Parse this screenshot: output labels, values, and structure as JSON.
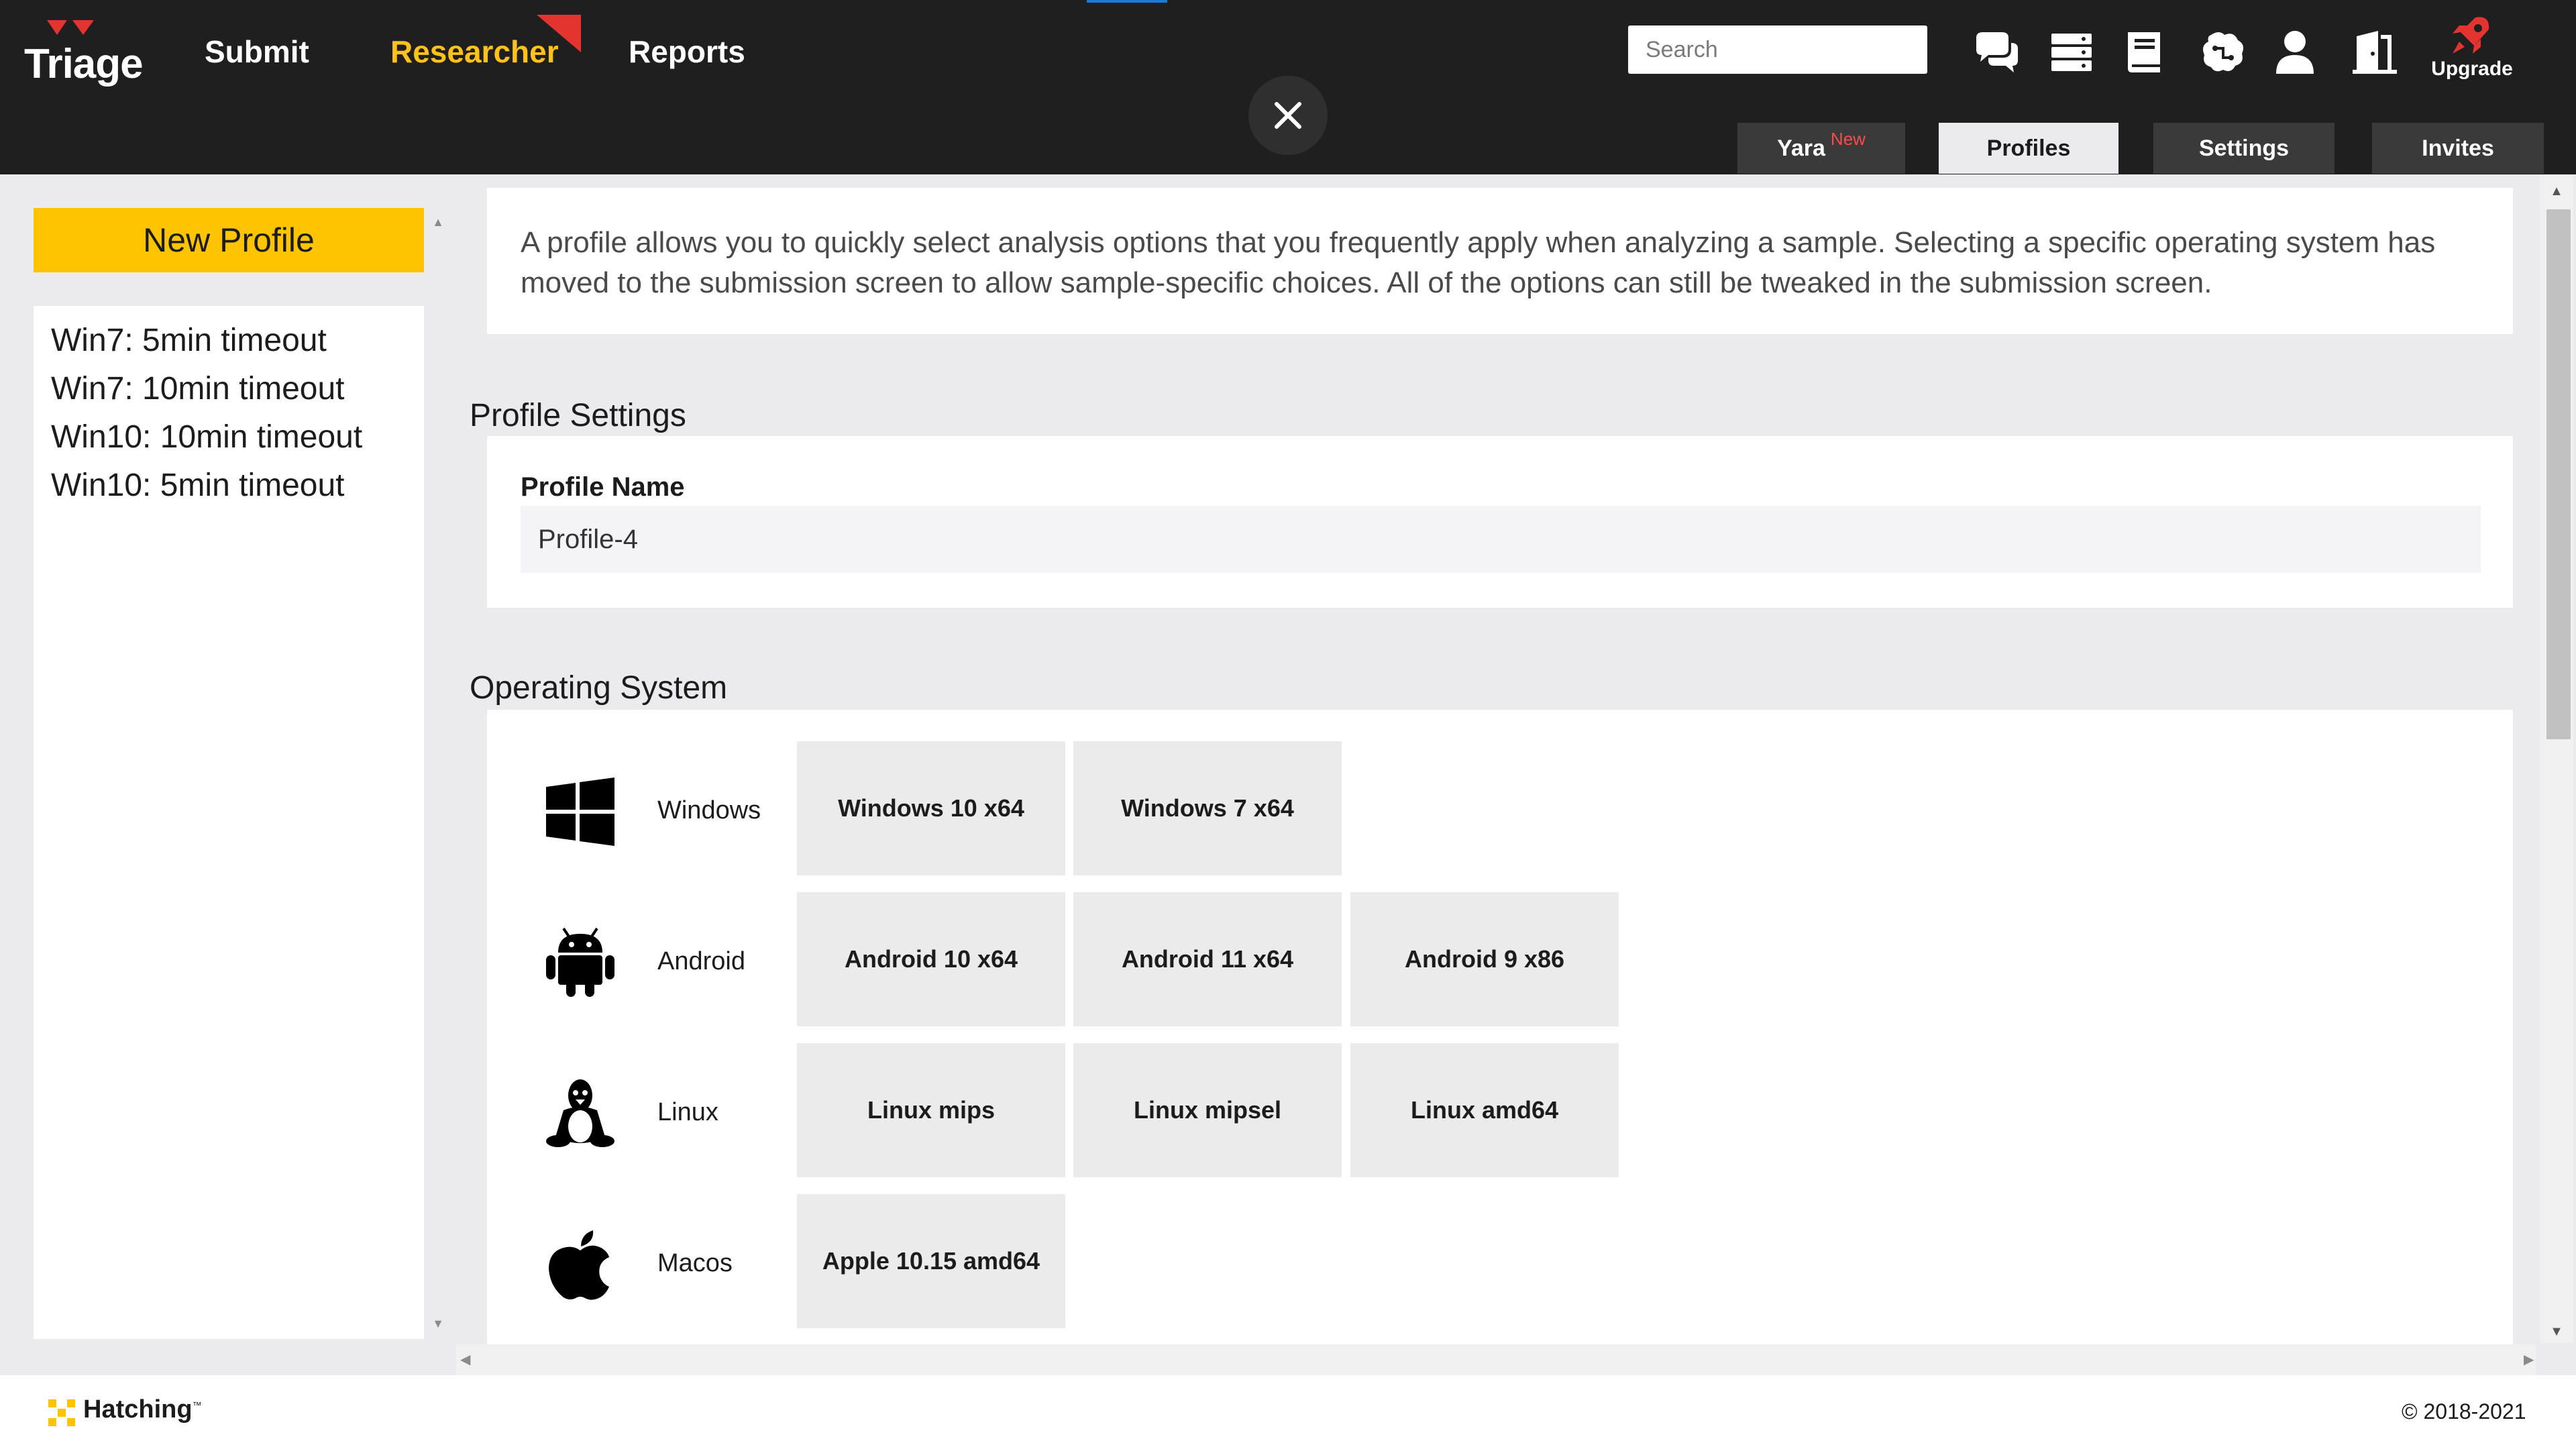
{
  "header": {
    "logo_text": "Triage",
    "nav": {
      "submit": "Submit",
      "researcher": "Researcher",
      "reports": "Reports"
    },
    "search_placeholder": "Search",
    "upgrade_label": "Upgrade",
    "tabs": {
      "yara": "Yara",
      "yara_badge": "New",
      "profiles": "Profiles",
      "settings": "Settings",
      "invites": "Invites"
    },
    "colors": {
      "accent": "#ffc21a",
      "topbar": "#1f1f1f",
      "badge": "#ff4a4a"
    }
  },
  "sidebar": {
    "new_profile_label": "New Profile",
    "profiles": [
      "Win7: 5min timeout",
      "Win7: 10min timeout",
      "Win10: 10min timeout",
      "Win10: 5min timeout"
    ]
  },
  "main": {
    "info_text": "A profile allows you to quickly select analysis options that you frequently apply when analyzing a sample. Selecting a specific operating system has moved to the submission screen to allow sample-specific choices. All of the options can still be tweaked in the submission screen.",
    "profile_settings_title": "Profile Settings",
    "profile_name_label": "Profile Name",
    "profile_name_value": "Profile-4",
    "os_title": "Operating System",
    "os_rows": [
      {
        "label": "Windows",
        "icon": "windows-icon",
        "options": [
          "Windows 10 x64",
          "Windows 7 x64"
        ]
      },
      {
        "label": "Android",
        "icon": "android-icon",
        "options": [
          "Android 10 x64",
          "Android 11 x64",
          "Android 9 x86"
        ]
      },
      {
        "label": "Linux",
        "icon": "linux-icon",
        "options": [
          "Linux mips",
          "Linux mipsel",
          "Linux amd64"
        ]
      },
      {
        "label": "Macos",
        "icon": "apple-icon",
        "options": [
          "Apple 10.15 amd64"
        ]
      }
    ]
  },
  "footer": {
    "brand": "Hatching",
    "trademark": "™",
    "copyright": "© 2018-2021"
  }
}
